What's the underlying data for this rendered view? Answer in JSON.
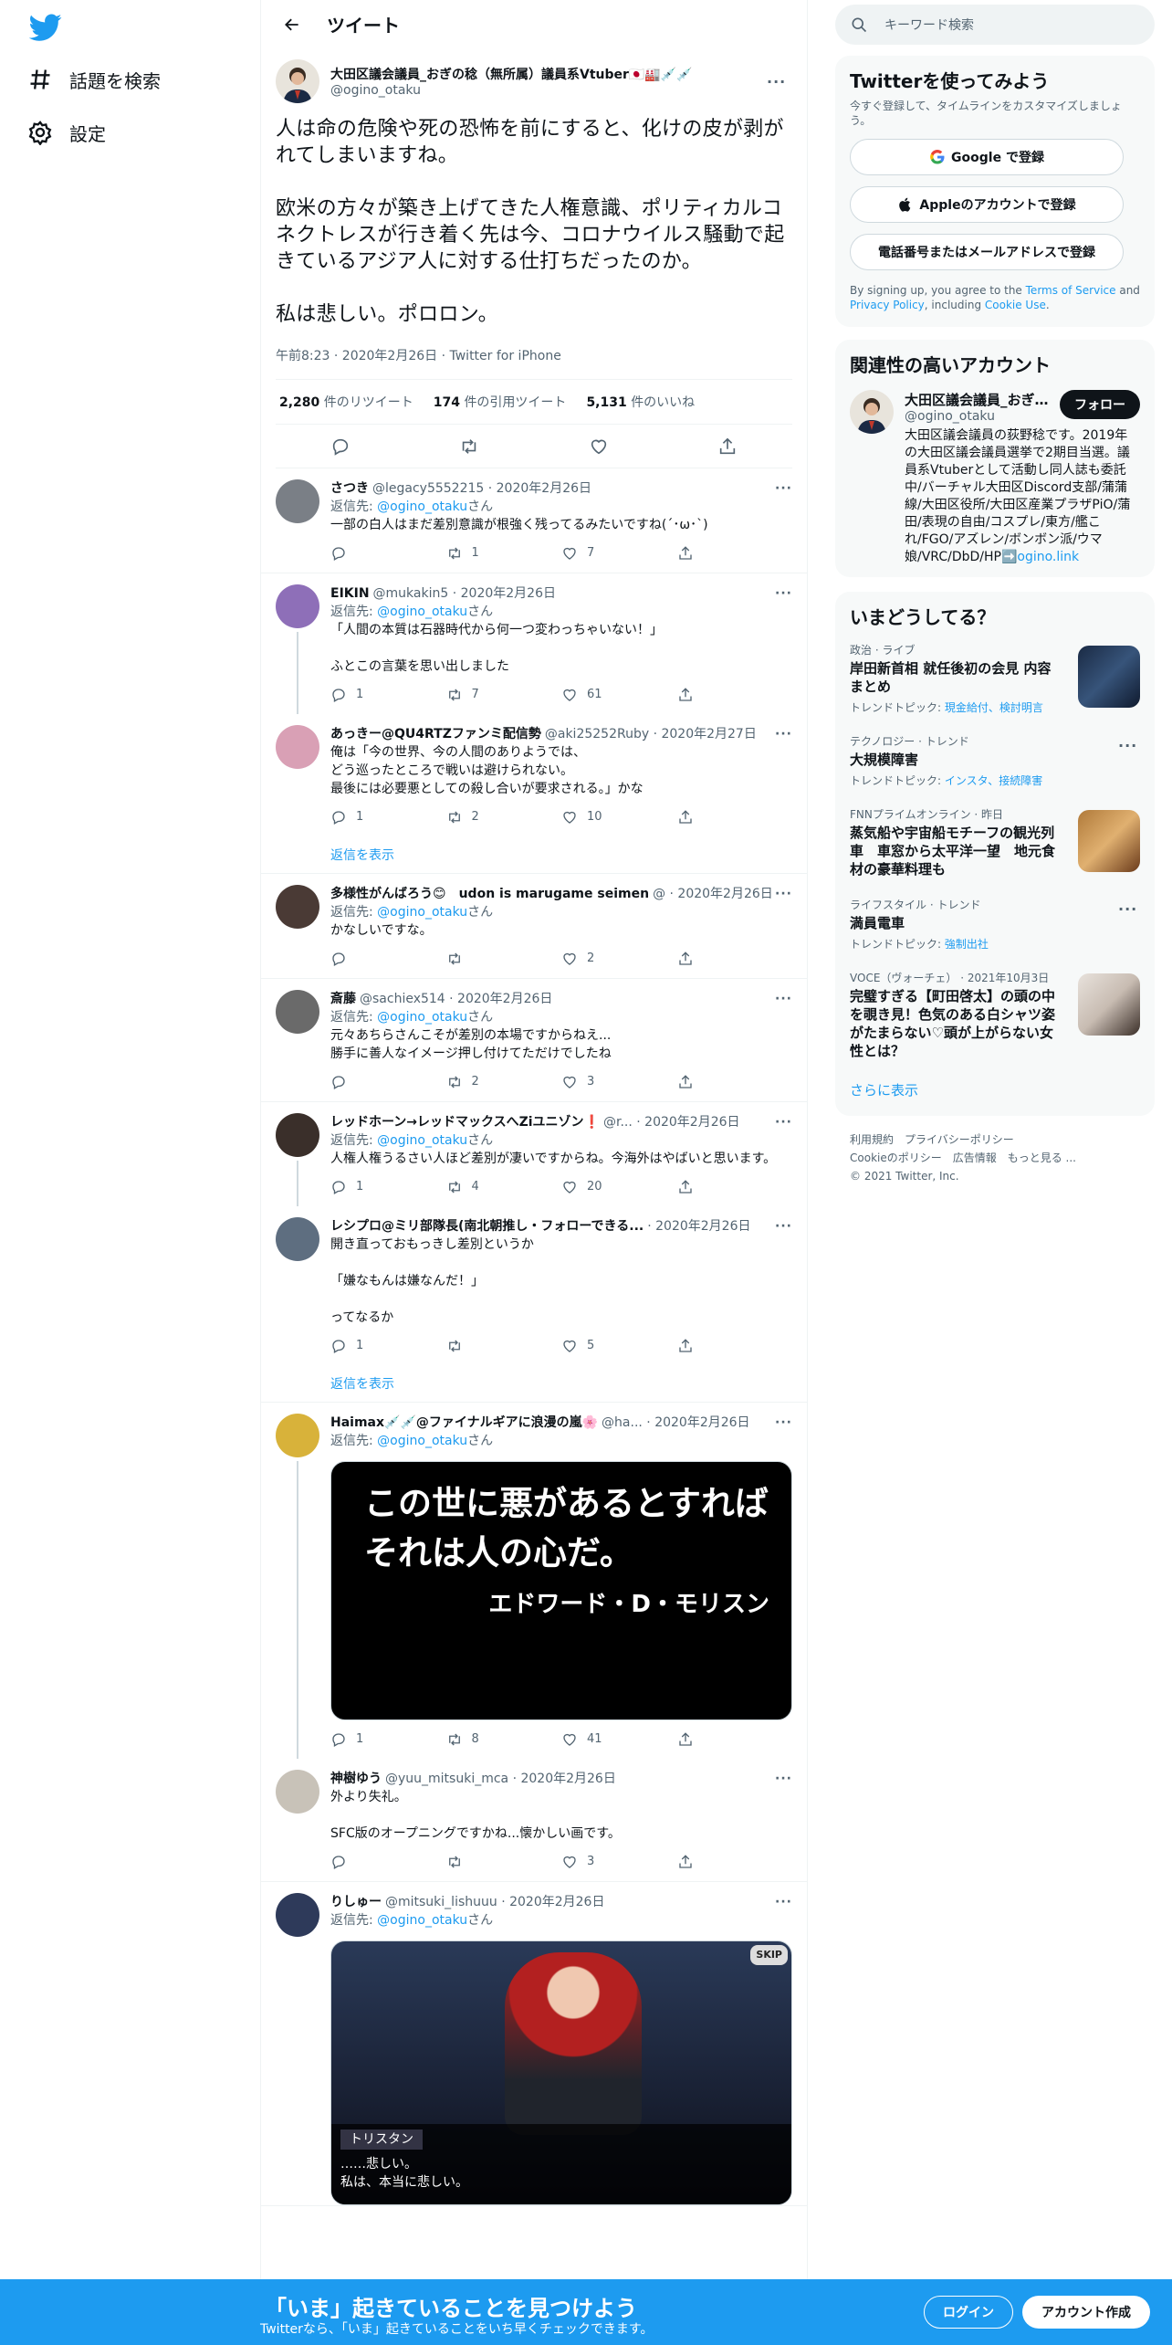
{
  "nav": {
    "explore": "話題を検索",
    "settings": "設定"
  },
  "header": {
    "title": "ツイート"
  },
  "main_tweet": {
    "name": "大田区議会議員_おぎの稔（無所属）議員系Vtuber🇯🇵🏭💉💉",
    "handle": "@ogino_otaku",
    "text": "人は命の危険や死の恐怖を前にすると、化けの皮が剥がれてしまいますね。\n\n欧米の方々が築き上げてきた人権意識、ポリティカルコネクトレスが行き着く先は今、コロナウイルス騒動で起きているアジア人に対する仕打ちだったのか。\n\n私は悲しい。ポロロン。",
    "meta": "午前8:23 · 2020年2月26日 · Twitter for iPhone",
    "retweets_n": "2,280",
    "retweets_l": "件のリツイート",
    "quotes_n": "174",
    "quotes_l": "件の引用ツイート",
    "likes_n": "5,131",
    "likes_l": "件のいいね"
  },
  "reply_prefix": "返信先: ",
  "reply_to": "@ogino_otaku",
  "reply_suffix": "さん",
  "show_more": "返信を表示",
  "replies": [
    {
      "name": "さつき",
      "sub": "@legacy5552215 · 2020年2月26日",
      "text": "一部の白人はまだ差別意識が根強く残ってるみたいですね(´･ω･`)",
      "reply": "",
      "rt": "1",
      "like": "7"
    },
    {
      "name": "EIKIN",
      "sub": "@mukakin5 · 2020年2月26日",
      "text": "「人間の本質は石器時代から何一つ変わっちゃいない！」\n\nふとこの言葉を思い出しました",
      "reply": "1",
      "rt": "7",
      "like": "61"
    },
    {
      "name": "あっきー@QU4RTZファンミ配信勢",
      "sub": "@aki25252Ruby · 2020年2月27日",
      "text": "俺は「今の世界、今の人間のありようでは、\nどう巡ったところで戦いは避けられない。\n最後には必要悪としての殺し合いが要求される。」かな",
      "reply": "1",
      "rt": "2",
      "like": "10"
    },
    {
      "name": "多様性がんばろう😊　udon is marugame seimen",
      "sub": "@ · 2020年2月26日",
      "text": "かなしいですな。",
      "reply": "",
      "rt": "",
      "like": "2"
    },
    {
      "name": "斎藤",
      "sub": "@sachiex514 · 2020年2月26日",
      "text": "元々あちらさんこそが差別の本場ですからねえ...\n勝手に善人なイメージ押し付けてただけでしたね",
      "reply": "",
      "rt": "2",
      "like": "3"
    },
    {
      "name": "レッドホーン→レッドマックスへZiユニゾン❗",
      "sub": "@r... · 2020年2月26日",
      "text": "人権人権うるさい人ほど差別が凄いですからね。今海外はやばいと思います。",
      "reply": "1",
      "rt": "4",
      "like": "20"
    },
    {
      "name": "レシプロ@ミリ部隊長(南北朝推し・フォローできる...",
      "sub": "· 2020年2月26日",
      "text": "開き直っておもっきし差別というか\n\n「嫌なもんは嫌なんだ！」\n\nってなるか",
      "reply": "1",
      "rt": "",
      "like": "5"
    },
    {
      "name": "Haimax💉💉@ファイナルギアに浪漫の嵐🌸",
      "sub": "@ha... · 2020年2月26日",
      "text": "",
      "reply": "1",
      "rt": "8",
      "like": "41"
    },
    {
      "name": "神樹ゆう",
      "sub": "@yuu_mitsuki_mca · 2020年2月26日",
      "text": "外より失礼。\n\nSFC版のオープニングですかね...懐かしい画です。",
      "reply": "",
      "rt": "",
      "like": "3"
    },
    {
      "name": "りしゅー",
      "sub": "@mitsuki_lishuuu · 2020年2月26日",
      "text": "",
      "reply": "",
      "rt": "",
      "like": ""
    }
  ],
  "media1": {
    "line1": "この世に悪があるとすれば",
    "line2": "それは人の心だ。",
    "line3": "エドワード・D・モリスン"
  },
  "media2": {
    "skip": "SKIP",
    "speaker": "トリスタン",
    "line1": "……悲しい。",
    "line2": "私は、本当に悲しい。"
  },
  "search": {
    "placeholder": "キーワード検索"
  },
  "signup": {
    "title": "Twitterを使ってみよう",
    "desc": "今すぐ登録して、タイムラインをカスタマイズしましょう。",
    "google": "Google で登録",
    "apple": "Appleのアカウントで登録",
    "phone": "電話番号またはメールアドレスで登録",
    "terms_a": "By signing up, you agree to the ",
    "terms_link": "Terms of Service",
    "terms_b": " and ",
    "privacy_link": "Privacy Policy",
    "terms_c": ", including ",
    "cookie_link": "Cookie Use",
    "terms_d": "."
  },
  "related": {
    "title": "関連性の高いアカウント",
    "name": "大田区議会議員_おぎの稔（",
    "handle": "@ogino_otaku",
    "follow": "フォロー",
    "bio": "大田区議会議員の荻野稔です。2019年の大田区議会議員選挙で2期目当選。議員系Vtuberとして活動し同人誌も委託中/バーチャル大田区Discord支部/蒲蒲線/大田区役所/大田区産業プラザPiO/蒲田/表現の自由/コスプレ/東方/艦これ/FGO/アズレン/ボンボン派/ウマ娘/VRC/DbD/HP",
    "link": "➡️ogino.link"
  },
  "trends": {
    "title": "いまどうしてる？",
    "items": [
      {
        "cat": "政治 · ライブ",
        "title": "岸田新首相 就任後初の会見 内容まとめ",
        "tp_label": "トレンドトピック: ",
        "tp": "現金給付、検討明言"
      },
      {
        "cat": "テクノロジー · トレンド",
        "title": "大規模障害",
        "tp_label": "トレンドトピック: ",
        "tp": "インスタ、接続障害"
      },
      {
        "cat": "FNNプライムオンライン · 昨日",
        "title": "蒸気船や宇宙船モチーフの観光列車　車窓から太平洋一望　地元食材の豪華料理も",
        "tp_label": "",
        "tp": ""
      },
      {
        "cat": "ライフスタイル · トレンド",
        "title": "満員電車",
        "tp_label": "トレンドトピック: ",
        "tp": "強制出社"
      },
      {
        "cat": "VOCE（ヴォーチェ） · 2021年10月3日",
        "title": "完璧すぎる【町田啓太】の頭の中を覗き見！色気のある白シャツ姿がたまらない♡頭が上がらない女性とは？",
        "tp_label": "",
        "tp": ""
      }
    ],
    "more": "さらに表示"
  },
  "footer": {
    "l1": "利用規約　プライバシーポリシー",
    "l2": "Cookieのポリシー　広告情報　もっと見る ...",
    "l3": "© 2021 Twitter, Inc."
  },
  "bottom": {
    "title": "「いま」起きていることを見つけよう",
    "sub": "Twitterなら、「いま」起きていることをいち早くチェックできます。",
    "login": "ログイン",
    "signup": "アカウント作成"
  }
}
